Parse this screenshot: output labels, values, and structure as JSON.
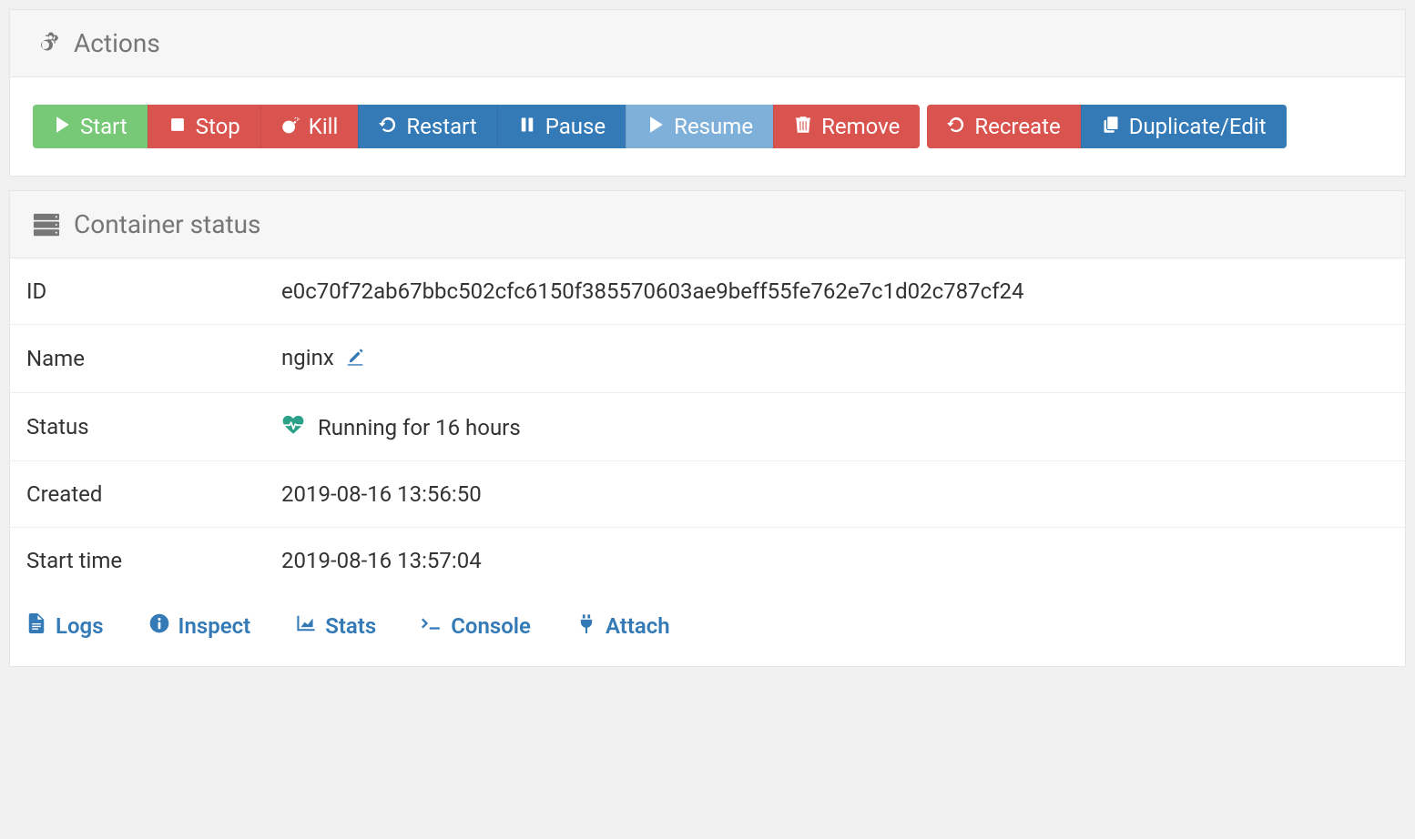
{
  "actions": {
    "title": "Actions",
    "buttons": {
      "start": "Start",
      "stop": "Stop",
      "kill": "Kill",
      "restart": "Restart",
      "pause": "Pause",
      "resume": "Resume",
      "remove": "Remove",
      "recreate": "Recreate",
      "duplicate": "Duplicate/Edit"
    }
  },
  "status_panel": {
    "title": "Container status",
    "rows": {
      "id_label": "ID",
      "id_value": "e0c70f72ab67bbc502cfc6150f385570603ae9beff55fe762e7c1d02c787cf24",
      "name_label": "Name",
      "name_value": "nginx",
      "status_label": "Status",
      "status_value": "Running for 16 hours",
      "created_label": "Created",
      "created_value": "2019-08-16 13:56:50",
      "start_label": "Start time",
      "start_value": "2019-08-16 13:57:04"
    },
    "links": {
      "logs": "Logs",
      "inspect": "Inspect",
      "stats": "Stats",
      "console": "Console",
      "attach": "Attach"
    }
  }
}
